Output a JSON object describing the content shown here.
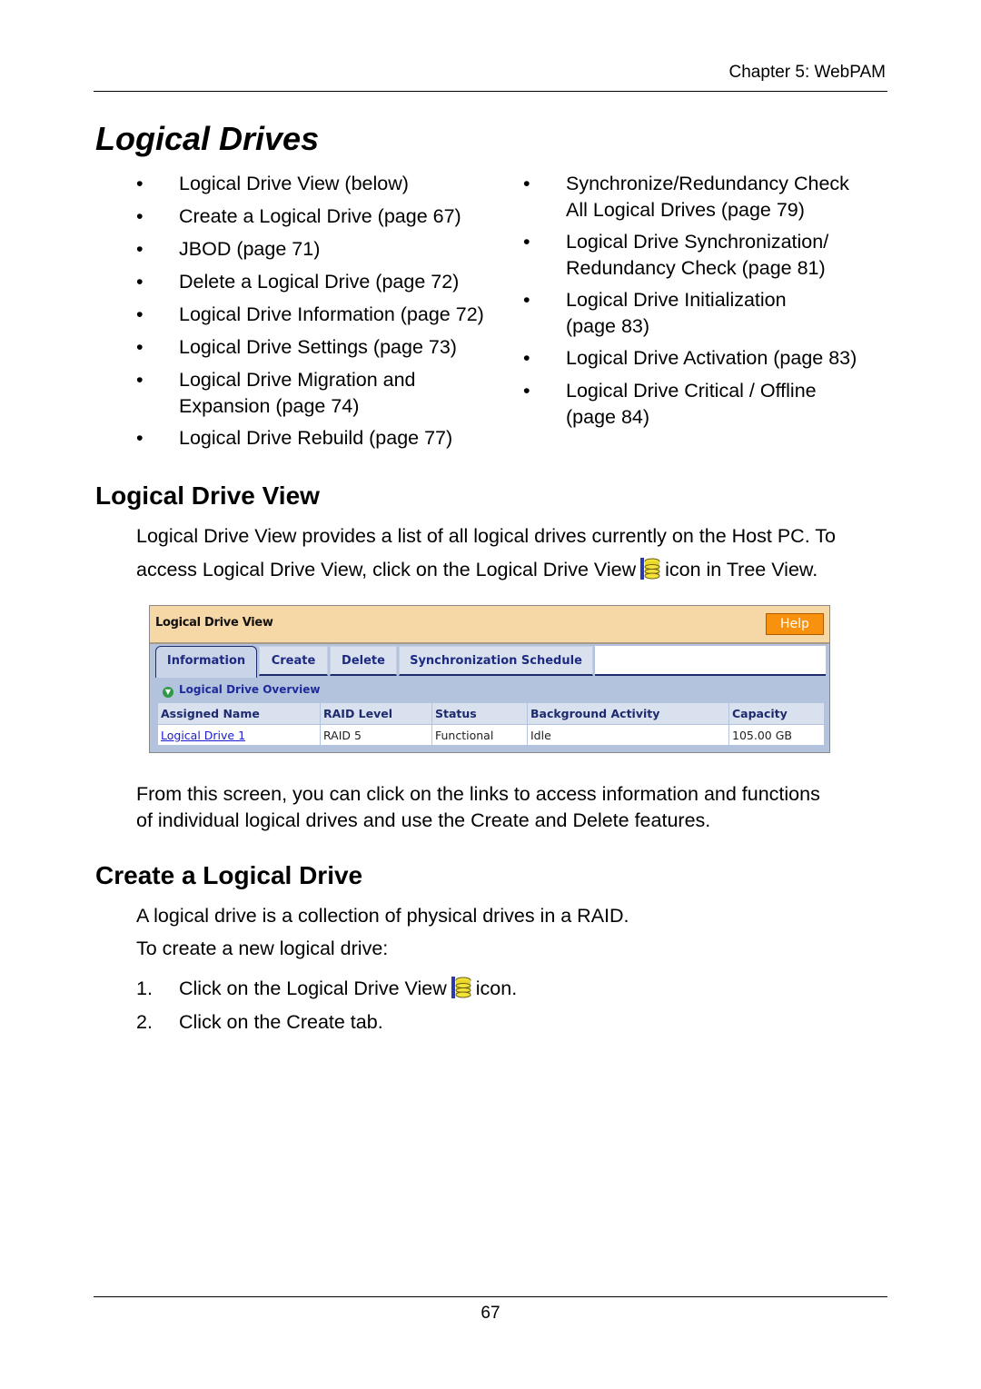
{
  "header": {
    "chapter": "Chapter 5: WebPAM"
  },
  "title": "Logical Drives",
  "toc_left": [
    [
      "Logical Drive View (below)"
    ],
    [
      "Create a Logical Drive (page 67)"
    ],
    [
      "JBOD (page 71)"
    ],
    [
      "Delete a Logical Drive (page 72)"
    ],
    [
      "Logical Drive Information (page 72)"
    ],
    [
      "Logical Drive Settings (page 73)"
    ],
    [
      "Logical Drive Migration and",
      "Expansion (page 74)"
    ],
    [
      "Logical Drive Rebuild (page 77)"
    ]
  ],
  "toc_right": [
    [
      "Synchronize/Redundancy Check",
      "All Logical Drives (page 79)"
    ],
    [
      "Logical Drive Synchronization/",
      "Redundancy Check (page 81)"
    ],
    [
      "Logical Drive Initialization",
      "(page 83)"
    ],
    [
      "Logical Drive Activation (page 83)"
    ],
    [
      "Logical Drive Critical / Offline",
      "(page 84)"
    ]
  ],
  "bullet": "•",
  "section1": {
    "heading": "Logical Drive View",
    "p1_line1": "Logical Drive View provides a list of all logical drives currently on the Host PC. To",
    "p1_line2a": "access Logical Drive View, click on the Logical Drive View",
    "p1_line2b": "icon in Tree View.",
    "p2_line1": "From this screen, you can click on the links to access information and functions",
    "p2_line2": "of individual logical drives and use the Create and Delete features."
  },
  "ui": {
    "panel_title": "Logical Drive View",
    "help_label": "Help",
    "tabs": [
      "Information",
      "Create",
      "Delete",
      "Synchronization Schedule"
    ],
    "active_tab": "Information",
    "overview_label": "Logical Drive Overview",
    "columns": [
      "Assigned Name",
      "RAID Level",
      "Status",
      "Background Activity",
      "Capacity"
    ],
    "rows": [
      [
        "Logical Drive 1",
        "RAID 5",
        "Functional",
        "Idle",
        "105.00 GB"
      ]
    ]
  },
  "section2": {
    "heading": "Create a Logical Drive",
    "p1": "A logical drive is a collection of physical drives in a RAID.",
    "p2": "To create a new logical drive:",
    "steps": [
      {
        "num": "1.",
        "text_a": "Click on the Logical Drive View",
        "text_b": "icon."
      },
      {
        "num": "2.",
        "text_a": "Click on the Create tab.",
        "text_b": ""
      }
    ]
  },
  "footer": {
    "page_number": "67"
  }
}
